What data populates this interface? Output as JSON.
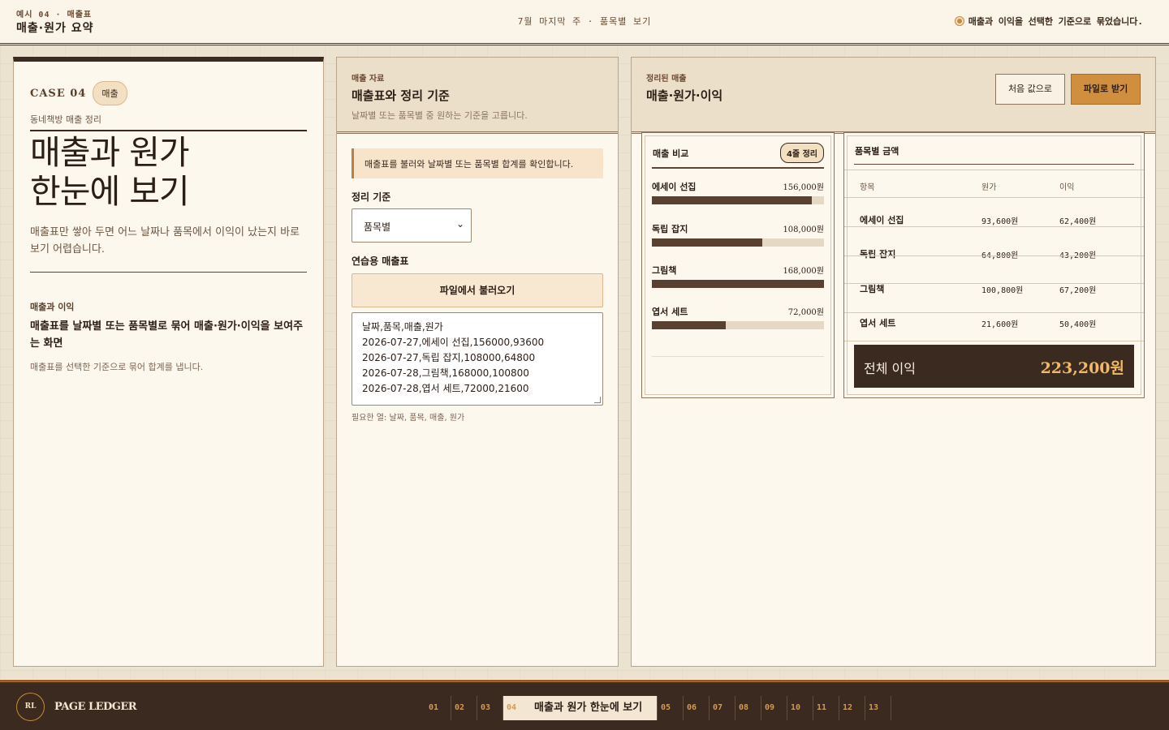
{
  "header": {
    "crumb": "예시 04 · 매출표",
    "title": "매출·원가 요약",
    "center": "7월 마지막 주 · 품목별 보기",
    "status": "매출과 이익을 선택한 기준으로 묶었습니다."
  },
  "intro": {
    "case_label": "CASE 04",
    "case_pill": "매출",
    "subtitle": "동네책방 매출 정리",
    "hero_line1": "매출과 원가",
    "hero_line2": "한눈에 보기",
    "description": "매출표만 쌓아 두면 어느 날짜나 품목에서 이익이 났는지 바로 보기 어렵습니다.",
    "kicker": "매출과 이익",
    "lead": "매출표를 날짜별 또는 품목별로 묶어 매출·원가·이익을 보여주는 화면",
    "note": "매출표를 선택한 기준으로 묶어 합계를 냅니다."
  },
  "input_panel": {
    "kicker": "매출 자료",
    "title": "매출표와 정리 기준",
    "subtitle": "날짜별 또는 품목별 중 원하는 기준을 고릅니다.",
    "notice": "매출표를 불러와 날짜별 또는 품목별 합계를 확인합니다.",
    "group_label": "정리 기준",
    "group_value": "품목별",
    "sample_label": "연습용 매출표",
    "file_button": "파일에서 불러오기",
    "csv_lines": [
      "날짜,품목,매출,원가",
      "2026-07-27,에세이 선집,156000,93600",
      "2026-07-27,독립 잡지,108000,64800",
      "2026-07-28,그림책,168000,100800",
      "2026-07-28,엽서 세트,72000,21600"
    ],
    "hint": "필요한 열: 날짜, 품목, 매출, 원가"
  },
  "result_panel": {
    "kicker": "정리된 매출",
    "title": "매출·원가·이익",
    "reset_button": "처음 값으로",
    "download_button": "파일로 받기"
  },
  "bar_card": {
    "title": "매출 비교",
    "badge": "4줄 정리",
    "max": 168000,
    "items": [
      {
        "name": "에세이 선집",
        "value": 156000,
        "label": "156,000원"
      },
      {
        "name": "독립 잡지",
        "value": 108000,
        "label": "108,000원"
      },
      {
        "name": "그림책",
        "value": 168000,
        "label": "168,000원"
      },
      {
        "name": "엽서 세트",
        "value": 72000,
        "label": "72,000원"
      }
    ]
  },
  "table_card": {
    "title": "품목별 금액",
    "headers": [
      "항목",
      "원가",
      "이익"
    ],
    "rows": [
      {
        "name": "에세이 선집",
        "cost": "93,600원",
        "profit": "62,400원"
      },
      {
        "name": "독립 잡지",
        "cost": "64,800원",
        "profit": "43,200원"
      },
      {
        "name": "그림책",
        "cost": "100,800원",
        "profit": "67,200원"
      },
      {
        "name": "엽서 세트",
        "cost": "21,600원",
        "profit": "50,400원"
      }
    ],
    "total_label": "전체 이익",
    "total_value": "223,200원"
  },
  "footer": {
    "logo": "RL",
    "brand": "PAGE LEDGER",
    "pages": [
      "01",
      "02",
      "03",
      "04",
      "05",
      "06",
      "07",
      "08",
      "09",
      "10",
      "11",
      "12",
      "13"
    ],
    "active_index": 3,
    "active_title": "매출과 원가 한눈에 보기"
  },
  "colors": {
    "accent": "#cf8f3f",
    "dark": "#3a2a1f",
    "bar_fill": "#5a4030",
    "background": "#ece2d0"
  }
}
